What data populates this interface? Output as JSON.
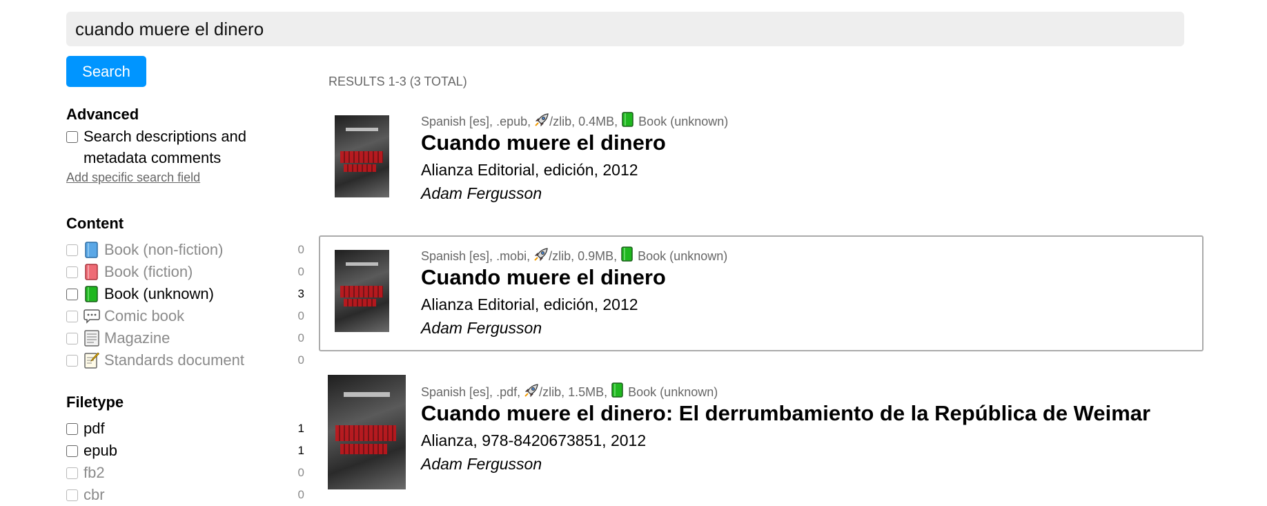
{
  "search": {
    "query": "cuando muere el dinero",
    "button_label": "Search"
  },
  "sidebar": {
    "advanced": {
      "title": "Advanced",
      "checkbox_label_line1": "Search descriptions and",
      "checkbox_label_line2": "metadata comments",
      "add_field_link": "Add specific search field"
    },
    "content": {
      "title": "Content",
      "items": [
        {
          "label": "Book (non-fiction)",
          "count": "0",
          "icon": "blue-book-icon"
        },
        {
          "label": "Book (fiction)",
          "count": "0",
          "icon": "red-book-icon"
        },
        {
          "label": "Book (unknown)",
          "count": "3",
          "icon": "green-book-icon"
        },
        {
          "label": "Comic book",
          "count": "0",
          "icon": "speech-bubble-icon"
        },
        {
          "label": "Magazine",
          "count": "0",
          "icon": "newspaper-icon"
        },
        {
          "label": "Standards document",
          "count": "0",
          "icon": "memo-icon"
        }
      ]
    },
    "filetype": {
      "title": "Filetype",
      "items": [
        {
          "label": "pdf",
          "count": "1"
        },
        {
          "label": "epub",
          "count": "1"
        },
        {
          "label": "fb2",
          "count": "0"
        },
        {
          "label": "cbr",
          "count": "0"
        }
      ]
    }
  },
  "results": {
    "header": "RESULTS 1-3 (3 TOTAL)",
    "items": [
      {
        "meta_prefix": "Spanish [es], .epub, ",
        "meta_source": "/zlib, 0.4MB, ",
        "meta_type": "Book (unknown)",
        "title": "Cuando muere el dinero",
        "publisher": "Alianza Editorial, edición, 2012",
        "author": "Adam Fergusson"
      },
      {
        "meta_prefix": "Spanish [es], .mobi, ",
        "meta_source": "/zlib, 0.9MB, ",
        "meta_type": "Book (unknown)",
        "title": "Cuando muere el dinero",
        "publisher": "Alianza Editorial, edición, 2012",
        "author": "Adam Fergusson"
      },
      {
        "meta_prefix": "Spanish [es], .pdf, ",
        "meta_source": "/zlib, 1.5MB, ",
        "meta_type": "Book (unknown)",
        "title": "Cuando muere el dinero: El derrumbamiento de la República de Weimar",
        "publisher": "Alianza, 978-8420673851, 2012",
        "author": "Adam Fergusson"
      }
    ]
  },
  "colors": {
    "accent": "#0095ff",
    "search_bg": "#eeeeee",
    "muted_text": "#666666"
  }
}
